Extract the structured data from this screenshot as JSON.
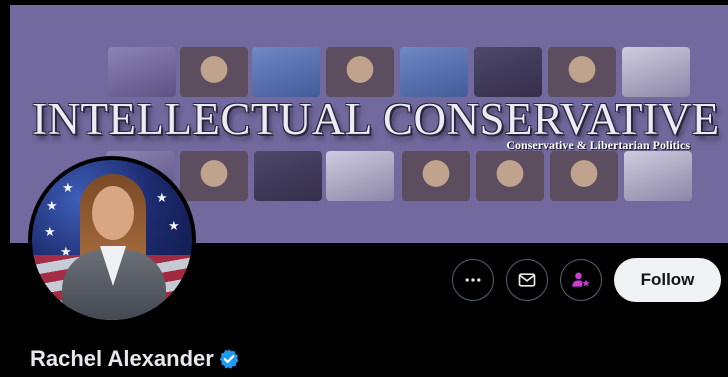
{
  "banner": {
    "title": "INTELLECTUAL CONSERVATIVE",
    "subtitle": "Conservative & Libertarian Politics",
    "background_color": "#726a9e"
  },
  "profile": {
    "avatar_alt": "Rachel Alexander profile photo",
    "display_name": "Rachel Alexander",
    "verified": true,
    "verified_badge_color": "#1d9bf0"
  },
  "actions": {
    "more_icon": "more-horizontal-icon",
    "message_icon": "envelope-icon",
    "subscribe_icon": "person-star-icon",
    "subscribe_icon_color": "#c93dd1",
    "follow_label": "Follow"
  }
}
